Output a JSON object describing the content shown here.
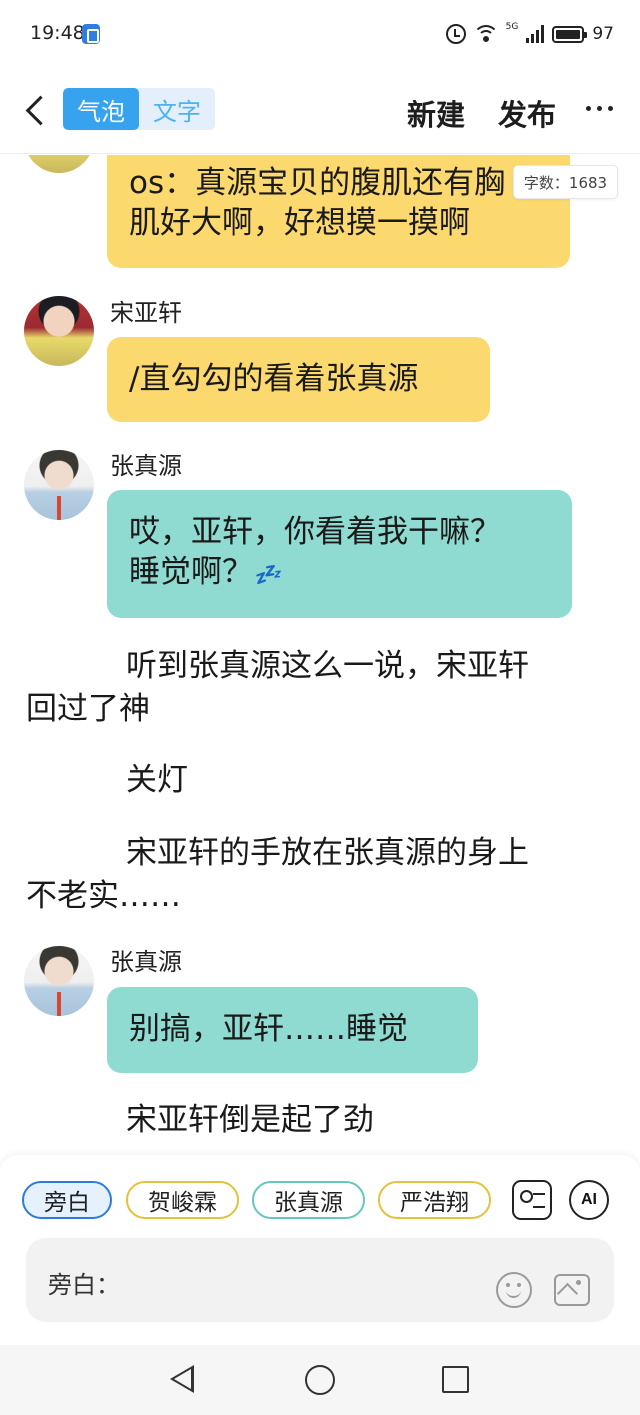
{
  "status": {
    "time": "19:48",
    "network": "5G",
    "battery_percent": "97",
    "battery_level": 0.97
  },
  "header": {
    "tab_bubble": "气泡",
    "tab_text": "文字",
    "new_label": "新建",
    "publish_label": "发布"
  },
  "word_count": "字数：1683",
  "messages": [
    {
      "speaker": "宋亚轩",
      "text_line1": "os：真源宝贝的腹肌还有胸",
      "text_line2": "肌好大啊，好想摸一摸啊"
    },
    {
      "speaker": "宋亚轩",
      "text": "/直勾勾的看着张真源"
    },
    {
      "speaker": "张真源",
      "text_line1": "哎，亚轩，你看着我干嘛？",
      "text_line2": "睡觉啊？",
      "emoji": "💤"
    },
    {
      "speaker": "张真源",
      "text": "别搞，亚轩……睡觉"
    }
  ],
  "narration": [
    {
      "line1": "听到张真源这么一说，宋亚轩",
      "line2": "回过了神"
    },
    {
      "line1": "关灯"
    },
    {
      "line1": "宋亚轩的手放在张真源的身上",
      "line2": "不老实……"
    },
    {
      "line1": "宋亚轩倒是起了劲"
    }
  ],
  "roles": [
    "旁白",
    "贺峻霖",
    "张真源",
    "严浩翔"
  ],
  "ai_label": "AI",
  "input": {
    "label": "旁白："
  },
  "colors": {
    "accent": "#37a3ef",
    "yellow_bubble": "#fcd96f",
    "teal_bubble": "#8fdbd1"
  }
}
